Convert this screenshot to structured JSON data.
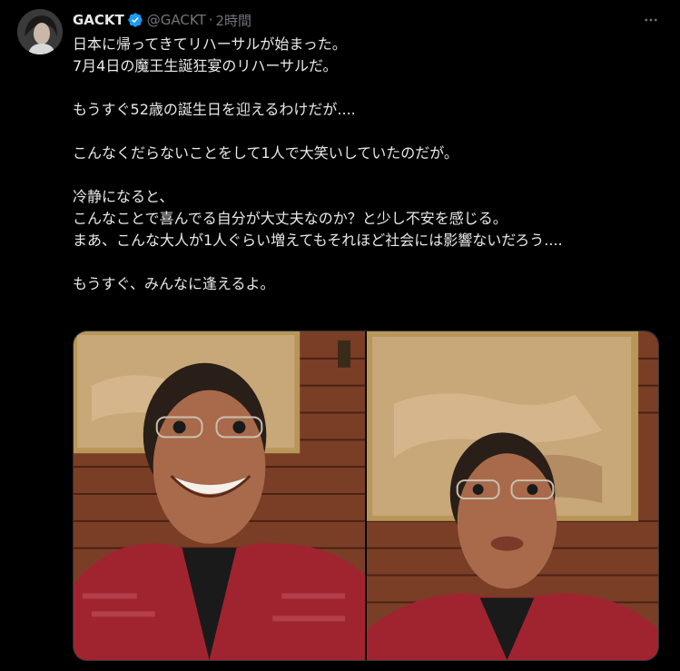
{
  "author": {
    "display_name": "GACKT",
    "handle": "@GACKT",
    "separator": "·",
    "time": "2時間",
    "verified": true
  },
  "icons": {
    "verified": "verified-badge-icon",
    "more": "more-options-icon"
  },
  "colors": {
    "background": "#000000",
    "text": "#e7e9ea",
    "muted": "#71767b",
    "verified_blue": "#1d9bf0"
  },
  "tweet": {
    "lines": [
      "日本に帰ってきてリハーサルが始まった。",
      "7月4日の魔王生誕狂宴のリハーサルだ。",
      "",
      "もうすぐ52歳の誕生日を迎えるわけだが....",
      "",
      "こんなくだらないことをして1人で大笑いしていたのだが。",
      "",
      "冷静になると、",
      "こんなことで喜んでる自分が大丈夫なのか？と少し不安を感じる。",
      "まあ、こんな大人が1人ぐらい増えてもそれほど社会には影響ないだろう....",
      "",
      "もうすぐ、みんなに逢えるよ。"
    ]
  },
  "media": {
    "count": 2
  }
}
